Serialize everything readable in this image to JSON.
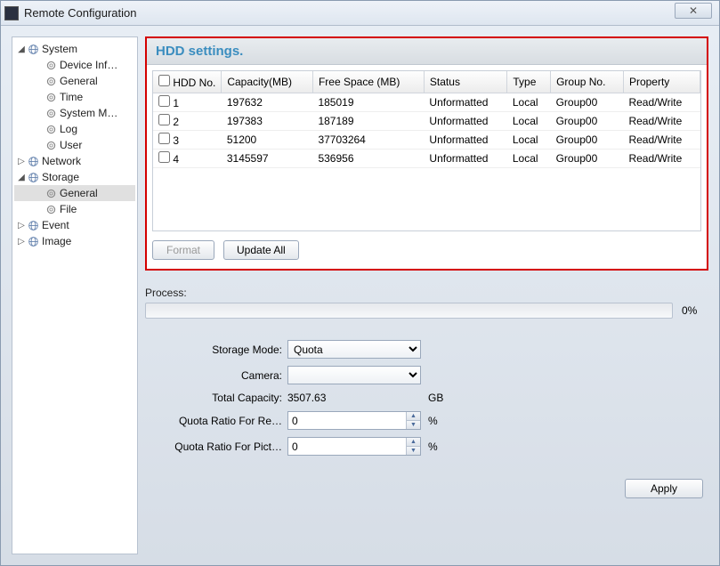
{
  "window": {
    "title": "Remote Configuration",
    "close_symbol": "✕"
  },
  "sidebar": {
    "items": [
      {
        "label": "System",
        "level": 1,
        "expanded": true,
        "icon": "globe"
      },
      {
        "label": "Device Inf…",
        "level": 2,
        "icon": "gear"
      },
      {
        "label": "General",
        "level": 2,
        "icon": "gear"
      },
      {
        "label": "Time",
        "level": 2,
        "icon": "gear"
      },
      {
        "label": "System M…",
        "level": 2,
        "icon": "gear"
      },
      {
        "label": "Log",
        "level": 2,
        "icon": "gear"
      },
      {
        "label": "User",
        "level": 2,
        "icon": "gear"
      },
      {
        "label": "Network",
        "level": 1,
        "collapsed": true,
        "icon": "globe"
      },
      {
        "label": "Storage",
        "level": 1,
        "expanded": true,
        "icon": "globe"
      },
      {
        "label": "General",
        "level": 2,
        "icon": "gear",
        "selected": true
      },
      {
        "label": "File",
        "level": 2,
        "icon": "gear"
      },
      {
        "label": "Event",
        "level": 1,
        "collapsed": true,
        "icon": "globe"
      },
      {
        "label": "Image",
        "level": 1,
        "collapsed": true,
        "icon": "globe"
      }
    ]
  },
  "hdd": {
    "title": "HDD settings.",
    "columns": [
      "HDD No.",
      "Capacity(MB)",
      "Free Space (MB)",
      "Status",
      "Type",
      "Group No.",
      "Property"
    ],
    "rows": [
      {
        "no": "1",
        "capacity": "197632",
        "free": "185019",
        "status": "Unformatted",
        "type": "Local",
        "group": "Group00",
        "property": "Read/Write"
      },
      {
        "no": "2",
        "capacity": "197383",
        "free": "187189",
        "status": "Unformatted",
        "type": "Local",
        "group": "Group00",
        "property": "Read/Write"
      },
      {
        "no": "3",
        "capacity": "51200",
        "free": "37703264",
        "status": "Unformatted",
        "type": "Local",
        "group": "Group00",
        "property": "Read/Write"
      },
      {
        "no": "4",
        "capacity": "3145597",
        "free": "536956",
        "status": "Unformatted",
        "type": "Local",
        "group": "Group00",
        "property": "Read/Write"
      }
    ],
    "buttons": {
      "format": "Format",
      "update_all": "Update All"
    }
  },
  "process": {
    "label": "Process:",
    "percent": "0%"
  },
  "form": {
    "storage_mode": {
      "label": "Storage Mode:",
      "value": "Quota",
      "options": [
        "Quota"
      ]
    },
    "camera": {
      "label": "Camera:",
      "value": "",
      "options": [
        ""
      ]
    },
    "total_capacity": {
      "label": "Total Capacity:",
      "value": "3507.63",
      "unit": "GB"
    },
    "quota_record": {
      "label": "Quota Ratio For Re…",
      "value": "0",
      "unit": "%"
    },
    "quota_picture": {
      "label": "Quota Ratio For Pict…",
      "value": "0",
      "unit": "%"
    }
  },
  "apply": {
    "label": "Apply"
  }
}
